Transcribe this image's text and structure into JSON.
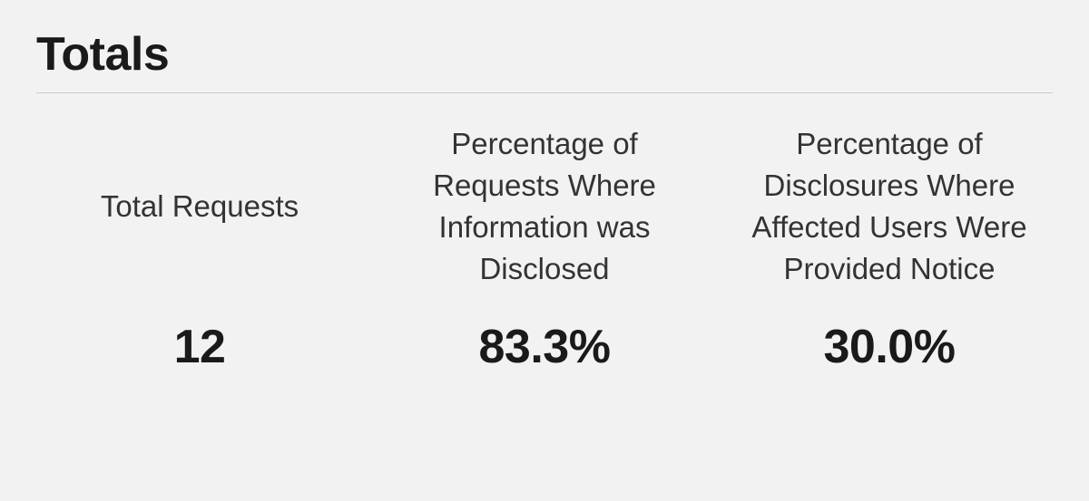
{
  "title": "Totals",
  "stats": [
    {
      "header": "Total Requests",
      "value": "12"
    },
    {
      "header": "Percentage of Requests Where Information was Disclosed",
      "value": "83.3%"
    },
    {
      "header": "Percentage of Disclosures Where Affected Users Were Provided Notice",
      "value": "30.0%"
    }
  ]
}
